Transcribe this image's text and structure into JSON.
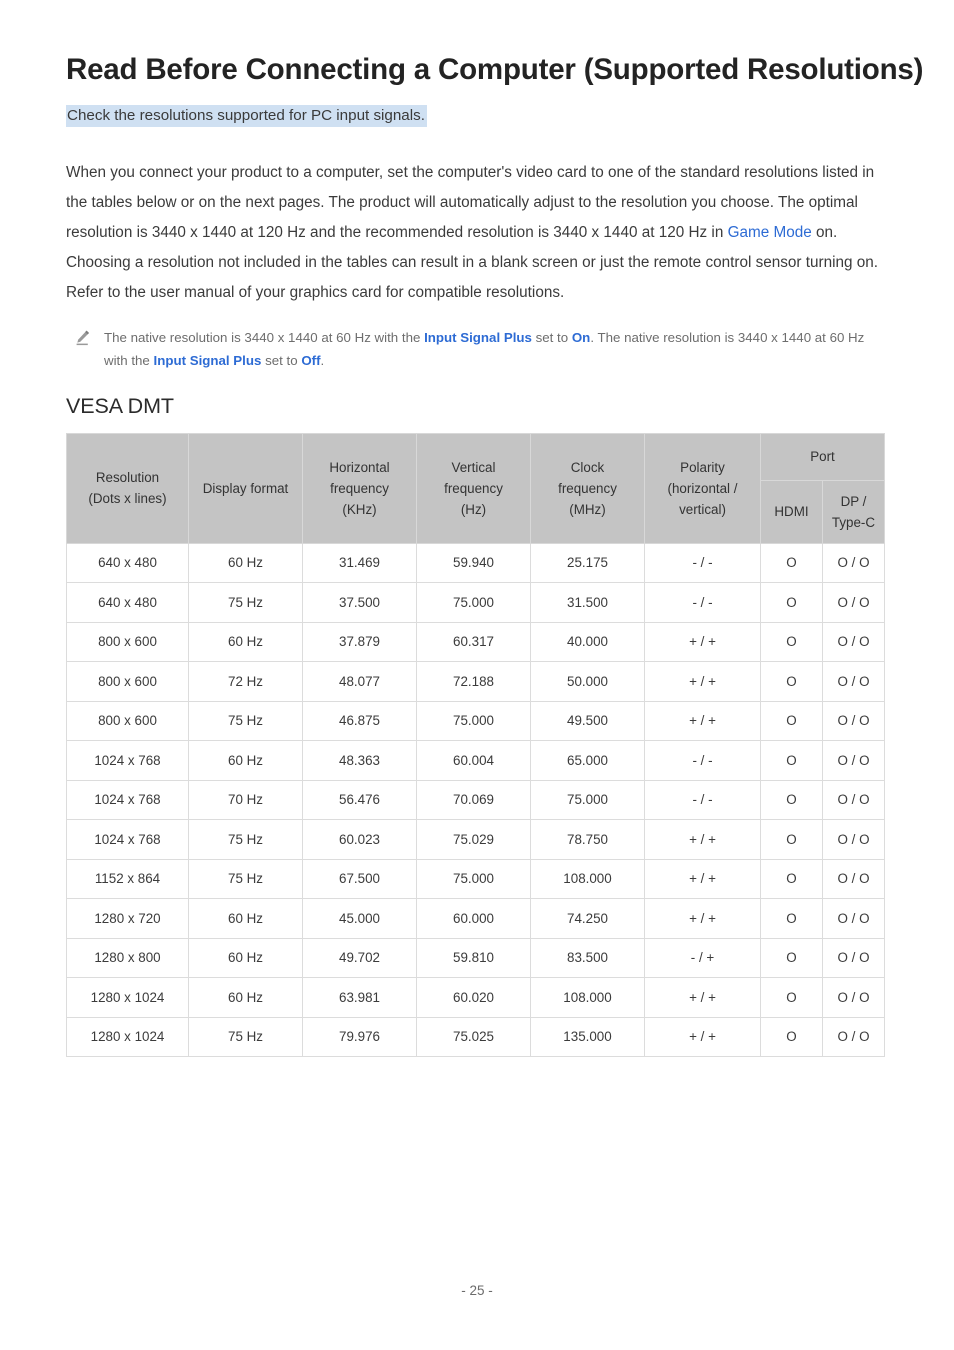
{
  "document": {
    "title": "Read Before Connecting a Computer (Supported Resolutions)",
    "highlight_note": "Check the resolutions supported for PC input signals.",
    "body_paragraph": {
      "part1": "When you connect your product to a computer, set the computer's video card to one of the standard resolutions listed in the tables below or on the next pages. The product will automatically adjust to the resolution you choose. The optimal resolution is 3440 x 1440 at 120 Hz and the recommended resolution is 3440 x 1440 at 120 Hz in ",
      "link1": "Game Mode",
      "part2": " on. Choosing a resolution not included in the tables can result in a blank screen or just the remote control sensor turning on. Refer to the user manual of your graphics card for compatible resolutions."
    },
    "note": {
      "icon": "pencil-icon",
      "text1": "The native resolution is 3440 x 1440 at 60 Hz with the ",
      "term1": "Input Signal Plus",
      "text2": " set to ",
      "term2": "On",
      "text3": ". The native resolution is 3440 x 1440 at 60 Hz with the ",
      "term3": "Input Signal Plus",
      "text4": " set to ",
      "term4": "Off",
      "text5": "."
    },
    "section_title": "VESA DMT",
    "page_number": "- 25 -"
  },
  "colors": {
    "highlight": "#cfe0f2",
    "link": "#2d6bd4",
    "table_header_bg": "#c4c4c4",
    "table_border": "#dcdcdc",
    "note_text": "#6d6d6d"
  },
  "table": {
    "headers": {
      "resolution_line1": "Resolution",
      "resolution_line2": "(Dots x lines)",
      "display_format": "Display format",
      "horizontal_line1": "Horizontal",
      "horizontal_line2": "frequency",
      "horizontal_line3": "(KHz)",
      "vertical_line1": "Vertical",
      "vertical_line2": "frequency",
      "vertical_line3": "(Hz)",
      "clock_line1": "Clock",
      "clock_line2": "frequency",
      "clock_line3": "(MHz)",
      "polarity_line1": "Polarity",
      "polarity_line2": "(horizontal /",
      "polarity_line3": "vertical)",
      "port": "Port",
      "hdmi": "HDMI",
      "dp_line1": "DP /",
      "dp_line2": "Type-C"
    },
    "columns": [
      "Resolution (Dots x lines)",
      "Display format",
      "Horizontal frequency (KHz)",
      "Vertical frequency (Hz)",
      "Clock frequency (MHz)",
      "Polarity (horizontal / vertical)",
      "HDMI",
      "DP / Type-C"
    ],
    "rows": [
      {
        "resolution": "640 x 480",
        "format": "60 Hz",
        "hfreq": "31.469",
        "vfreq": "59.940",
        "clock": "25.175",
        "polarity": "- / -",
        "hdmi": "O",
        "dp": "O / O"
      },
      {
        "resolution": "640 x 480",
        "format": "75 Hz",
        "hfreq": "37.500",
        "vfreq": "75.000",
        "clock": "31.500",
        "polarity": "- / -",
        "hdmi": "O",
        "dp": "O / O"
      },
      {
        "resolution": "800 x 600",
        "format": "60 Hz",
        "hfreq": "37.879",
        "vfreq": "60.317",
        "clock": "40.000",
        "polarity": "+ / +",
        "hdmi": "O",
        "dp": "O / O"
      },
      {
        "resolution": "800 x 600",
        "format": "72 Hz",
        "hfreq": "48.077",
        "vfreq": "72.188",
        "clock": "50.000",
        "polarity": "+ / +",
        "hdmi": "O",
        "dp": "O / O"
      },
      {
        "resolution": "800 x 600",
        "format": "75 Hz",
        "hfreq": "46.875",
        "vfreq": "75.000",
        "clock": "49.500",
        "polarity": "+ / +",
        "hdmi": "O",
        "dp": "O / O"
      },
      {
        "resolution": "1024 x 768",
        "format": "60 Hz",
        "hfreq": "48.363",
        "vfreq": "60.004",
        "clock": "65.000",
        "polarity": "- / -",
        "hdmi": "O",
        "dp": "O / O"
      },
      {
        "resolution": "1024 x 768",
        "format": "70 Hz",
        "hfreq": "56.476",
        "vfreq": "70.069",
        "clock": "75.000",
        "polarity": "- / -",
        "hdmi": "O",
        "dp": "O / O"
      },
      {
        "resolution": "1024 x 768",
        "format": "75 Hz",
        "hfreq": "60.023",
        "vfreq": "75.029",
        "clock": "78.750",
        "polarity": "+ / +",
        "hdmi": "O",
        "dp": "O / O"
      },
      {
        "resolution": "1152 x 864",
        "format": "75 Hz",
        "hfreq": "67.500",
        "vfreq": "75.000",
        "clock": "108.000",
        "polarity": "+ / +",
        "hdmi": "O",
        "dp": "O / O"
      },
      {
        "resolution": "1280 x 720",
        "format": "60 Hz",
        "hfreq": "45.000",
        "vfreq": "60.000",
        "clock": "74.250",
        "polarity": "+ / +",
        "hdmi": "O",
        "dp": "O / O"
      },
      {
        "resolution": "1280 x 800",
        "format": "60 Hz",
        "hfreq": "49.702",
        "vfreq": "59.810",
        "clock": "83.500",
        "polarity": "- / +",
        "hdmi": "O",
        "dp": "O / O"
      },
      {
        "resolution": "1280 x 1024",
        "format": "60 Hz",
        "hfreq": "63.981",
        "vfreq": "60.020",
        "clock": "108.000",
        "polarity": "+ / +",
        "hdmi": "O",
        "dp": "O / O"
      },
      {
        "resolution": "1280 x 1024",
        "format": "75 Hz",
        "hfreq": "79.976",
        "vfreq": "75.025",
        "clock": "135.000",
        "polarity": "+ / +",
        "hdmi": "O",
        "dp": "O / O"
      }
    ]
  }
}
